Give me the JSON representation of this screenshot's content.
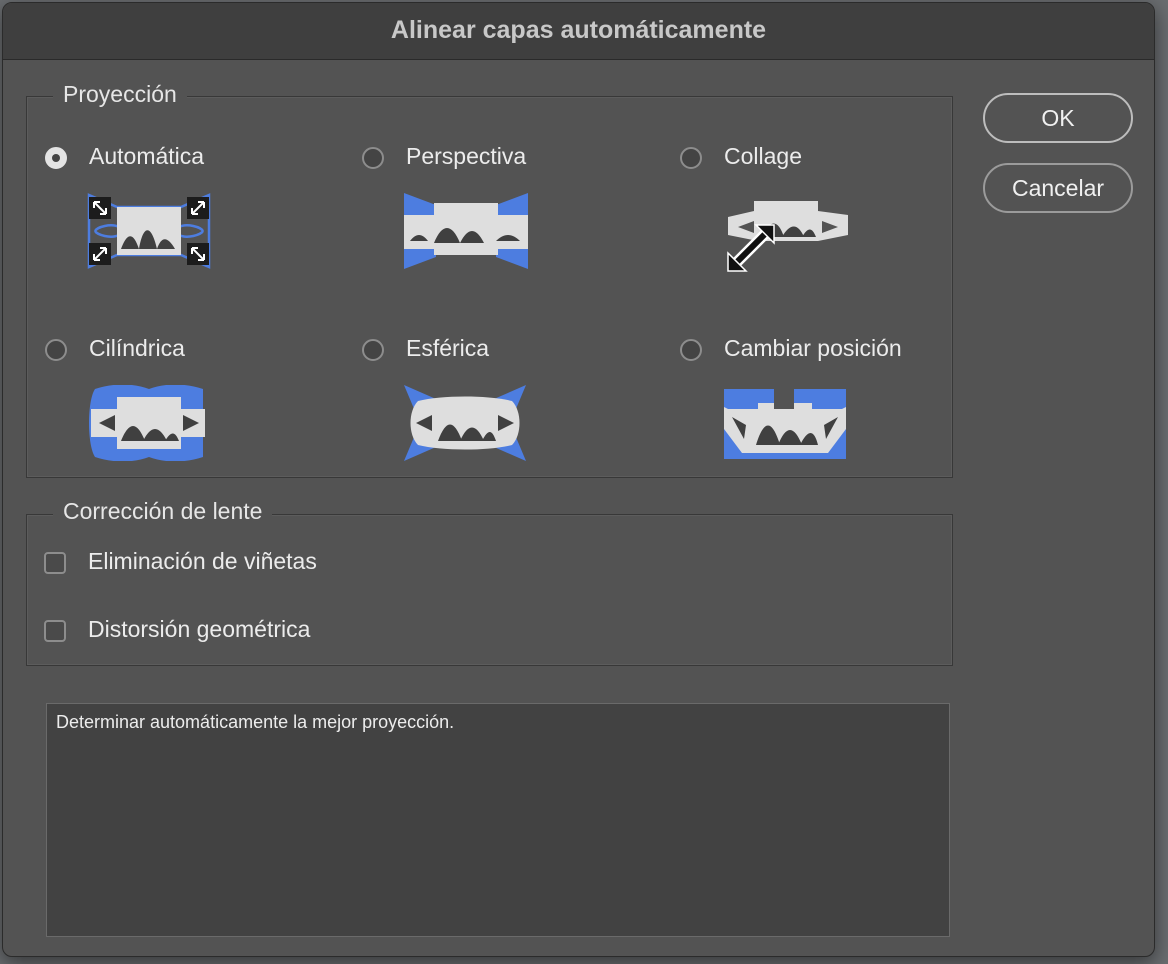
{
  "window": {
    "title": "Alinear capas automáticamente"
  },
  "projection": {
    "legend": "Proyección",
    "selected": "auto",
    "options": [
      {
        "id": "auto",
        "label": "Automática",
        "icon": "auto-projection-icon",
        "checked": true
      },
      {
        "id": "perspective",
        "label": "Perspectiva",
        "icon": "perspective-projection-icon",
        "checked": false
      },
      {
        "id": "collage",
        "label": "Collage",
        "icon": "collage-projection-icon",
        "checked": false
      },
      {
        "id": "cylindrical",
        "label": "Cilíndrica",
        "icon": "cylindrical-projection-icon",
        "checked": false
      },
      {
        "id": "spherical",
        "label": "Esférica",
        "icon": "spherical-projection-icon",
        "checked": false
      },
      {
        "id": "reposition",
        "label": "Cambiar posición",
        "icon": "reposition-projection-icon",
        "checked": false
      }
    ]
  },
  "lens": {
    "legend": "Corrección de lente",
    "options": [
      {
        "id": "vignette",
        "label": "Eliminación de viñetas",
        "checked": false
      },
      {
        "id": "distortion",
        "label": "Distorsión geométrica",
        "checked": false
      }
    ]
  },
  "buttons": {
    "ok": "OK",
    "cancel": "Cancelar"
  },
  "description": "Determinar automáticamente la mejor proyección.",
  "colors": {
    "accent_blue": "#4d7de0",
    "icon_light": "#dedede",
    "icon_dark": "#404040",
    "dialog_bg": "#535353"
  }
}
